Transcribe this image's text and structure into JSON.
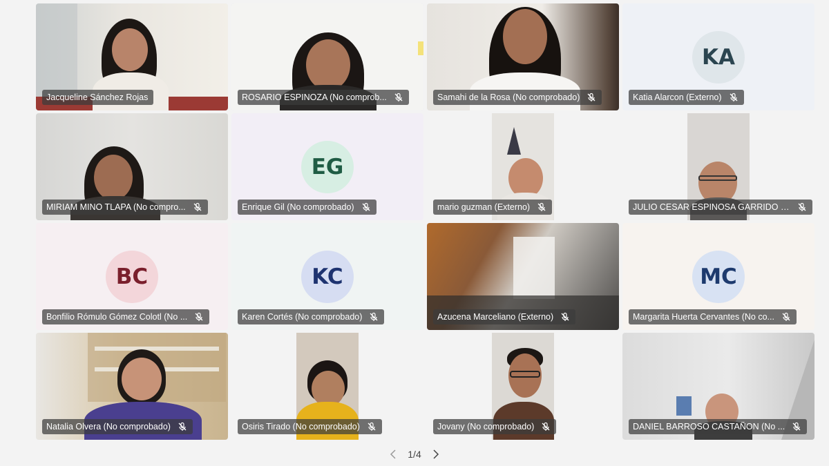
{
  "participants": [
    {
      "name": "Jacqueline Sánchez Rojas",
      "muted": false,
      "kind": "video"
    },
    {
      "name": "ROSARIO ESPINOZA (No comprob...",
      "muted": true,
      "kind": "video"
    },
    {
      "name": "Samahi de la Rosa (No comprobado)",
      "muted": true,
      "kind": "video"
    },
    {
      "name": "Katia Alarcon (Externo)",
      "muted": true,
      "kind": "avatar",
      "initials": "KA",
      "avatar_bg": "#dfe6ea",
      "avatar_fg": "#2b4550"
    },
    {
      "name": "MIRIAM MINO TLAPA (No compro...",
      "muted": true,
      "kind": "video"
    },
    {
      "name": "Enrique Gil (No comprobado)",
      "muted": true,
      "kind": "avatar",
      "initials": "EG",
      "avatar_bg": "#d7eee3",
      "avatar_fg": "#1f5c44"
    },
    {
      "name": "mario guzman (Externo)",
      "muted": true,
      "kind": "video"
    },
    {
      "name": "JULIO CESAR ESPINOSA GARRIDO (...",
      "muted": true,
      "kind": "video"
    },
    {
      "name": "Bonfilio Rómulo Gómez Colotl (No ...",
      "muted": true,
      "kind": "avatar",
      "initials": "BC",
      "avatar_bg": "#f3d6da",
      "avatar_fg": "#7a1f2c"
    },
    {
      "name": "Karen Cortés (No comprobado)",
      "muted": true,
      "kind": "avatar",
      "initials": "KC",
      "avatar_bg": "#d6ddf2",
      "avatar_fg": "#1e3370"
    },
    {
      "name": "Azucena Marceliano (Externo)",
      "muted": true,
      "kind": "video"
    },
    {
      "name": "Margarita Huerta Cervantes (No co...",
      "muted": true,
      "kind": "avatar",
      "initials": "MC",
      "avatar_bg": "#d8e2f3",
      "avatar_fg": "#1d3a6e"
    },
    {
      "name": "Natalia Olvera (No comprobado)",
      "muted": true,
      "kind": "video"
    },
    {
      "name": "Osiris Tirado (No comprobado)",
      "muted": true,
      "kind": "video"
    },
    {
      "name": "Jovany (No comprobado)",
      "muted": true,
      "kind": "video"
    },
    {
      "name": "DANIEL BARROSO CASTAÑON (No ...",
      "muted": true,
      "kind": "video"
    }
  ],
  "pager": {
    "label": "1/4"
  }
}
